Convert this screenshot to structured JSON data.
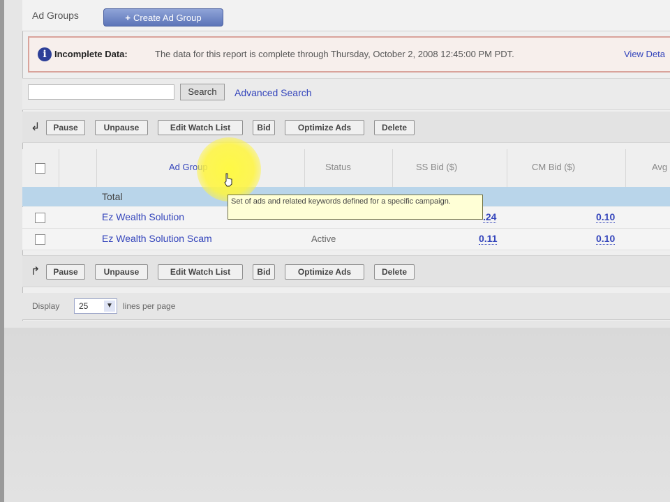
{
  "header": {
    "title": "Ad Groups",
    "create_button": "Create Ad Group"
  },
  "alert": {
    "label": "Incomplete Data:",
    "message": "The data for this report is complete through Thursday, October 2, 2008 12:45:00 PM PDT.",
    "link": "View Deta"
  },
  "search": {
    "value": "",
    "button": "Search",
    "advanced_link": "Advanced Search"
  },
  "toolbar": {
    "buttons": [
      "Pause",
      "Unpause",
      "Edit Watch List",
      "Bid",
      "Optimize Ads",
      "Delete"
    ]
  },
  "table": {
    "columns": [
      "Ad Group",
      "Status",
      "SS Bid ($)",
      "CM Bid ($)",
      "Avg"
    ],
    "total_label": "Total",
    "rows": [
      {
        "name": "Ez Wealth Solution",
        "status": "",
        "ss_bid": ".24",
        "cm_bid": "0.10"
      },
      {
        "name": "Ez Wealth Solution Scam",
        "status": "Active",
        "ss_bid": "0.11",
        "cm_bid": "0.10"
      }
    ]
  },
  "tooltip": {
    "text": "Set of ads and related keywords defined for a specific campaign."
  },
  "footer": {
    "display_label": "Display",
    "per_page": "25",
    "lines_label": "lines per page"
  },
  "colors": {
    "link": "#3344bb",
    "total_row": "#b9d5ea",
    "highlight": "#fff83c"
  }
}
